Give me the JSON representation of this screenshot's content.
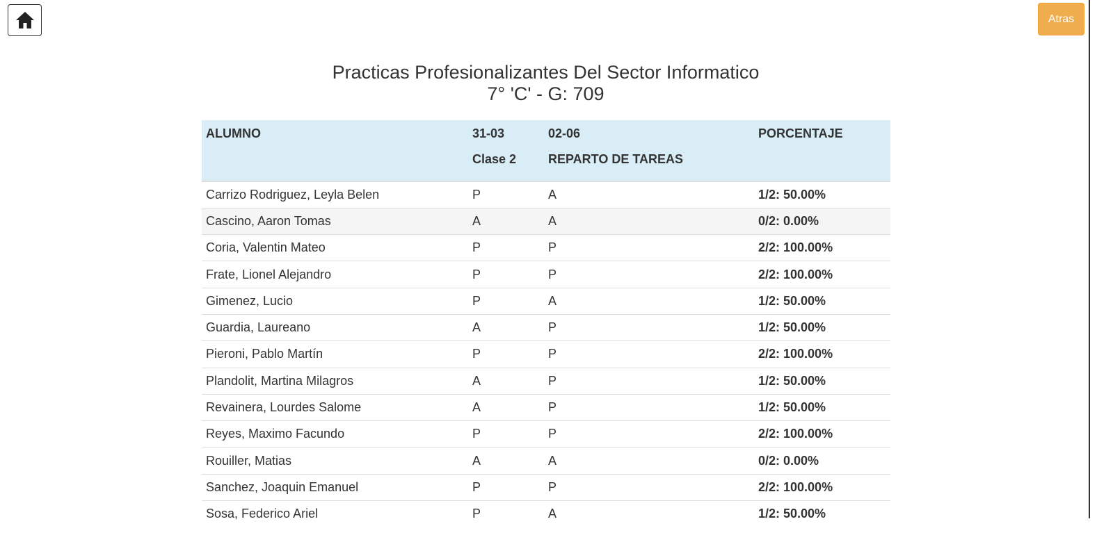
{
  "nav": {
    "back_label": "Atras"
  },
  "header": {
    "title": "Practicas Profesionalizantes Del Sector Informatico",
    "subtitle": "7° 'C' - G: 709"
  },
  "table": {
    "columns": [
      {
        "line1": "ALUMNO",
        "line2": ""
      },
      {
        "line1": "31-03",
        "line2": "Clase 2"
      },
      {
        "line1": "02-06",
        "line2": "REPARTO DE TAREAS"
      },
      {
        "line1": "PORCENTAJE",
        "line2": ""
      }
    ],
    "rows": [
      {
        "alumno": "Carrizo Rodriguez, Leyla Belen",
        "c1": "P",
        "c2": "A",
        "porcentaje": "1/2: 50.00%"
      },
      {
        "alumno": "Cascino, Aaron Tomas",
        "c1": "A",
        "c2": "A",
        "porcentaje": "0/2: 0.00%"
      },
      {
        "alumno": "Coria, Valentin Mateo",
        "c1": "P",
        "c2": "P",
        "porcentaje": "2/2: 100.00%"
      },
      {
        "alumno": "Frate, Lionel Alejandro",
        "c1": "P",
        "c2": "P",
        "porcentaje": "2/2: 100.00%"
      },
      {
        "alumno": "Gimenez, Lucio",
        "c1": "P",
        "c2": "A",
        "porcentaje": "1/2: 50.00%"
      },
      {
        "alumno": "Guardia, Laureano",
        "c1": "A",
        "c2": "P",
        "porcentaje": "1/2: 50.00%"
      },
      {
        "alumno": "Pieroni, Pablo Martín",
        "c1": "P",
        "c2": "P",
        "porcentaje": "2/2: 100.00%"
      },
      {
        "alumno": "Plandolit, Martina Milagros",
        "c1": "A",
        "c2": "P",
        "porcentaje": "1/2: 50.00%"
      },
      {
        "alumno": "Revainera, Lourdes Salome",
        "c1": "A",
        "c2": "P",
        "porcentaje": "1/2: 50.00%"
      },
      {
        "alumno": "Reyes, Maximo Facundo",
        "c1": "P",
        "c2": "P",
        "porcentaje": "2/2: 100.00%"
      },
      {
        "alumno": "Rouiller, Matias",
        "c1": "A",
        "c2": "A",
        "porcentaje": "0/2: 0.00%"
      },
      {
        "alumno": "Sanchez, Joaquin Emanuel",
        "c1": "P",
        "c2": "P",
        "porcentaje": "2/2: 100.00%"
      },
      {
        "alumno": "Sosa, Federico Ariel",
        "c1": "P",
        "c2": "A",
        "porcentaje": "1/2: 50.00%"
      }
    ]
  }
}
